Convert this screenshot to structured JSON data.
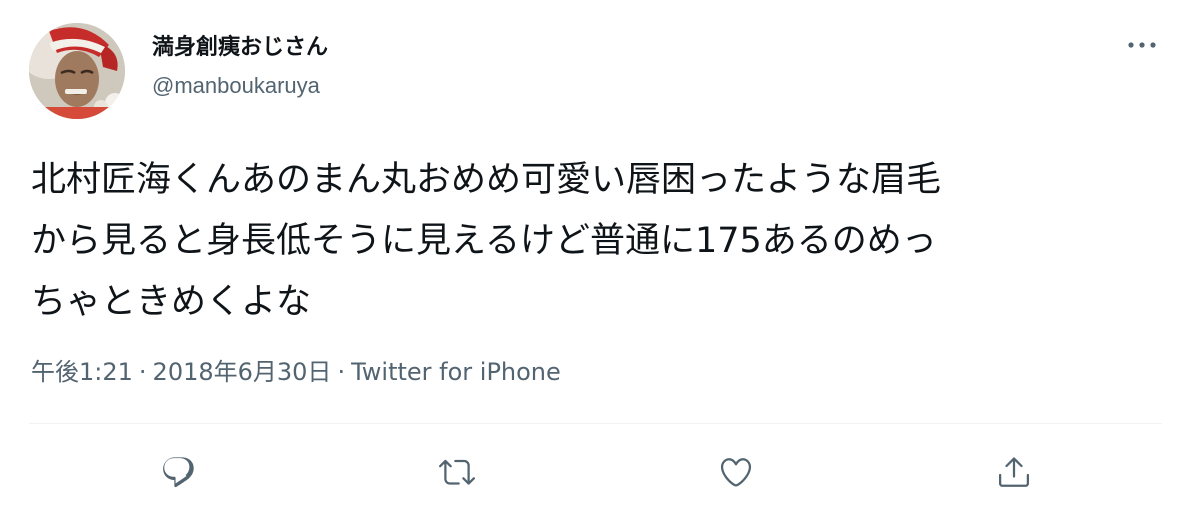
{
  "user": {
    "display_name": "満身創痍おじさん",
    "handle": "@manboukaruya",
    "avatar_icon": "user-avatar"
  },
  "tweet": {
    "text": "北村匠海くんあのまん丸おめめ可愛い唇困ったような眉毛\nから見ると身長低そうに見えるけど普通に175あるのめっ\nちゃときめくよな"
  },
  "meta": {
    "time": "午後1:21",
    "separator": "·",
    "date": "2018年6月30日",
    "source": "Twitter for iPhone"
  },
  "actions": {
    "reply_icon": "reply-icon",
    "retweet_icon": "retweet-icon",
    "like_icon": "heart-icon",
    "share_icon": "share-icon"
  },
  "colors": {
    "text": "#0f1419",
    "secondary": "#536471",
    "divider": "#eff3f4"
  }
}
